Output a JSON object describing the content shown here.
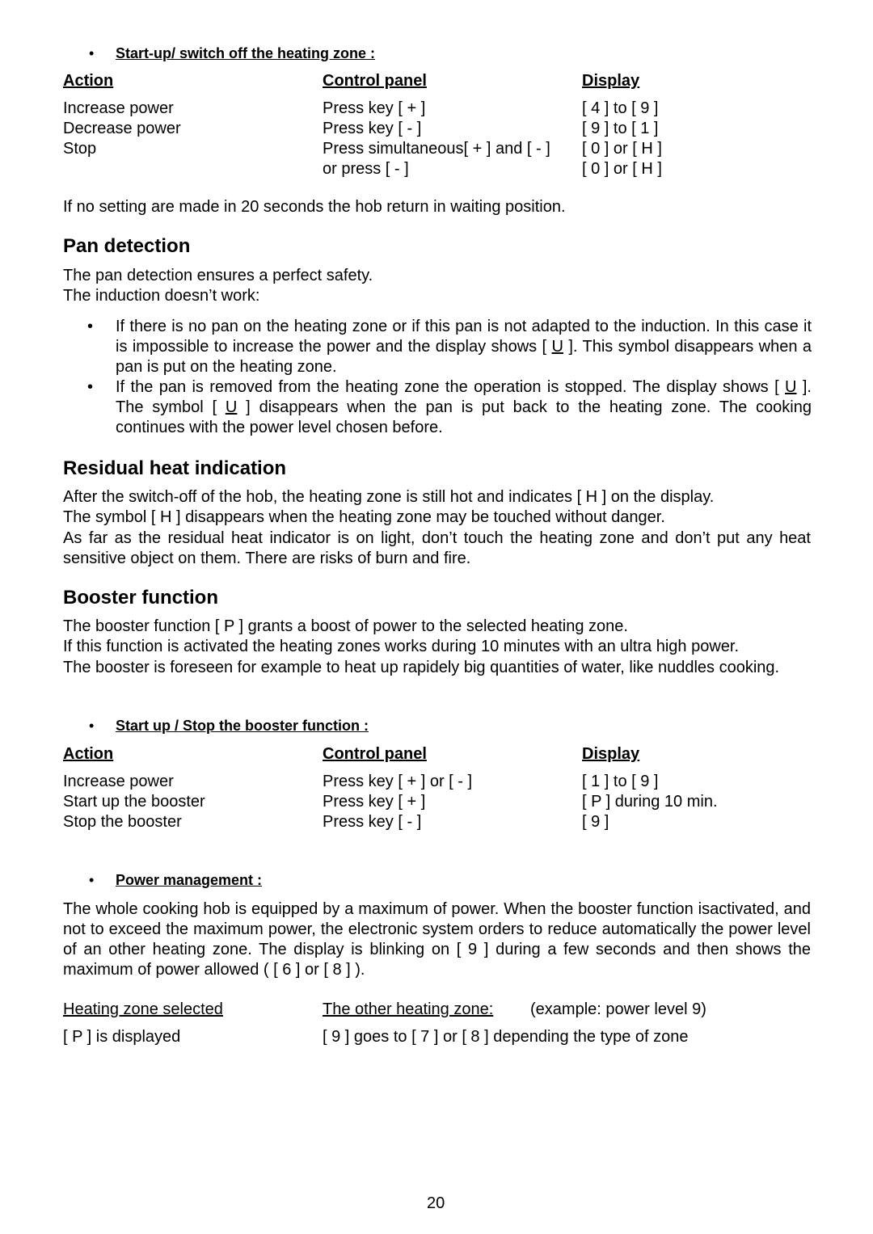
{
  "startup_section": {
    "bullet": "•",
    "title": "Start-up/ switch off the heating zone :",
    "headers": [
      "Action",
      "Control panel",
      "Display"
    ],
    "rows": [
      [
        "Increase power",
        "Press key [ + ]",
        "[ 4 ] to [ 9 ]"
      ],
      [
        "Decrease power",
        "Press key [ - ]",
        "[ 9 ] to [ 1 ]"
      ],
      [
        "Stop",
        "Press simultaneous[ + ] and [ - ]",
        "[ 0 ] or [ H ]"
      ],
      [
        "",
        "or press [ - ]",
        "[ 0 ] or [ H ]"
      ]
    ],
    "note": "If no setting are made in 20 seconds the hob return in waiting position."
  },
  "pan_detection": {
    "heading": "Pan detection",
    "lines": [
      "The pan detection ensures a perfect safety.",
      "The induction doesn’t work:"
    ],
    "bullets": [
      {
        "before": "If there is no pan on the heating zone or if this pan is not adapted to the induction. In this case it is impossible to increase the power and the display shows [ ",
        "symbol": "U",
        "after": " ]. This symbol disappears when a pan is put on the heating zone."
      },
      {
        "before": "If the pan is removed from the heating zone the operation is stopped. The display shows [ ",
        "symbol": "U",
        "middle": " ]. The symbol [ ",
        "symbol2": "U",
        "after": " ] disappears when the pan is put back to the heating zone. The cooking continues with the power level chosen before."
      }
    ]
  },
  "residual_heat": {
    "heading": "Residual heat indication",
    "lines": [
      "After the switch-off of the hob, the heating zone is still hot and indicates [ H ] on the display.",
      "The symbol [ H ] disappears when the heating zone may be touched without danger.",
      "As far as the residual heat indicator is on light, don’t touch the heating zone and don’t put any heat sensitive object on them. There are risks of burn and fire."
    ]
  },
  "booster": {
    "heading": "Booster function",
    "lines": [
      "The booster function [ P ] grants a boost of power to the selected heating zone.",
      "If this function is activated the heating zones works during 10 minutes with an ultra high power.",
      "The booster is foreseen for example to heat up rapidely big quantities of water, like nuddles cooking."
    ],
    "table": {
      "bullet": "•",
      "title": "Start up / Stop the booster  function :",
      "headers": [
        "Action",
        "Control panel",
        "Display"
      ],
      "rows": [
        [
          "Increase power",
          "Press key [ + ] or [ - ]",
          "[ 1 ] to [ 9 ]"
        ],
        [
          "Start up the booster",
          "Press key [ + ]",
          "[ P ] during 10 min."
        ],
        [
          "Stop the booster",
          "Press key [ - ]",
          "[ 9 ]"
        ]
      ]
    }
  },
  "power_management": {
    "bullet": "•",
    "title": "Power management :",
    "text": "The whole cooking hob is equipped by a maximum of power. When the booster function isactivated, and not to exceed the maximum power, the electronic system orders to reduce automatically the power level of an other heating zone. The display is blinking on [ 9 ] during a few seconds and then shows the maximum of power allowed ( [ 6 ] or [ 8 ] ).",
    "col1_header": "Heating zone selected",
    "col2_header": "The other heating zone:",
    "col2_note": "(example: power  level 9)",
    "col1_value": "[ P ] is displayed",
    "col2_value": "[ 9 ] goes to [ 7 ] or [ 8 ] depending the type of zone"
  },
  "page_number": "20"
}
